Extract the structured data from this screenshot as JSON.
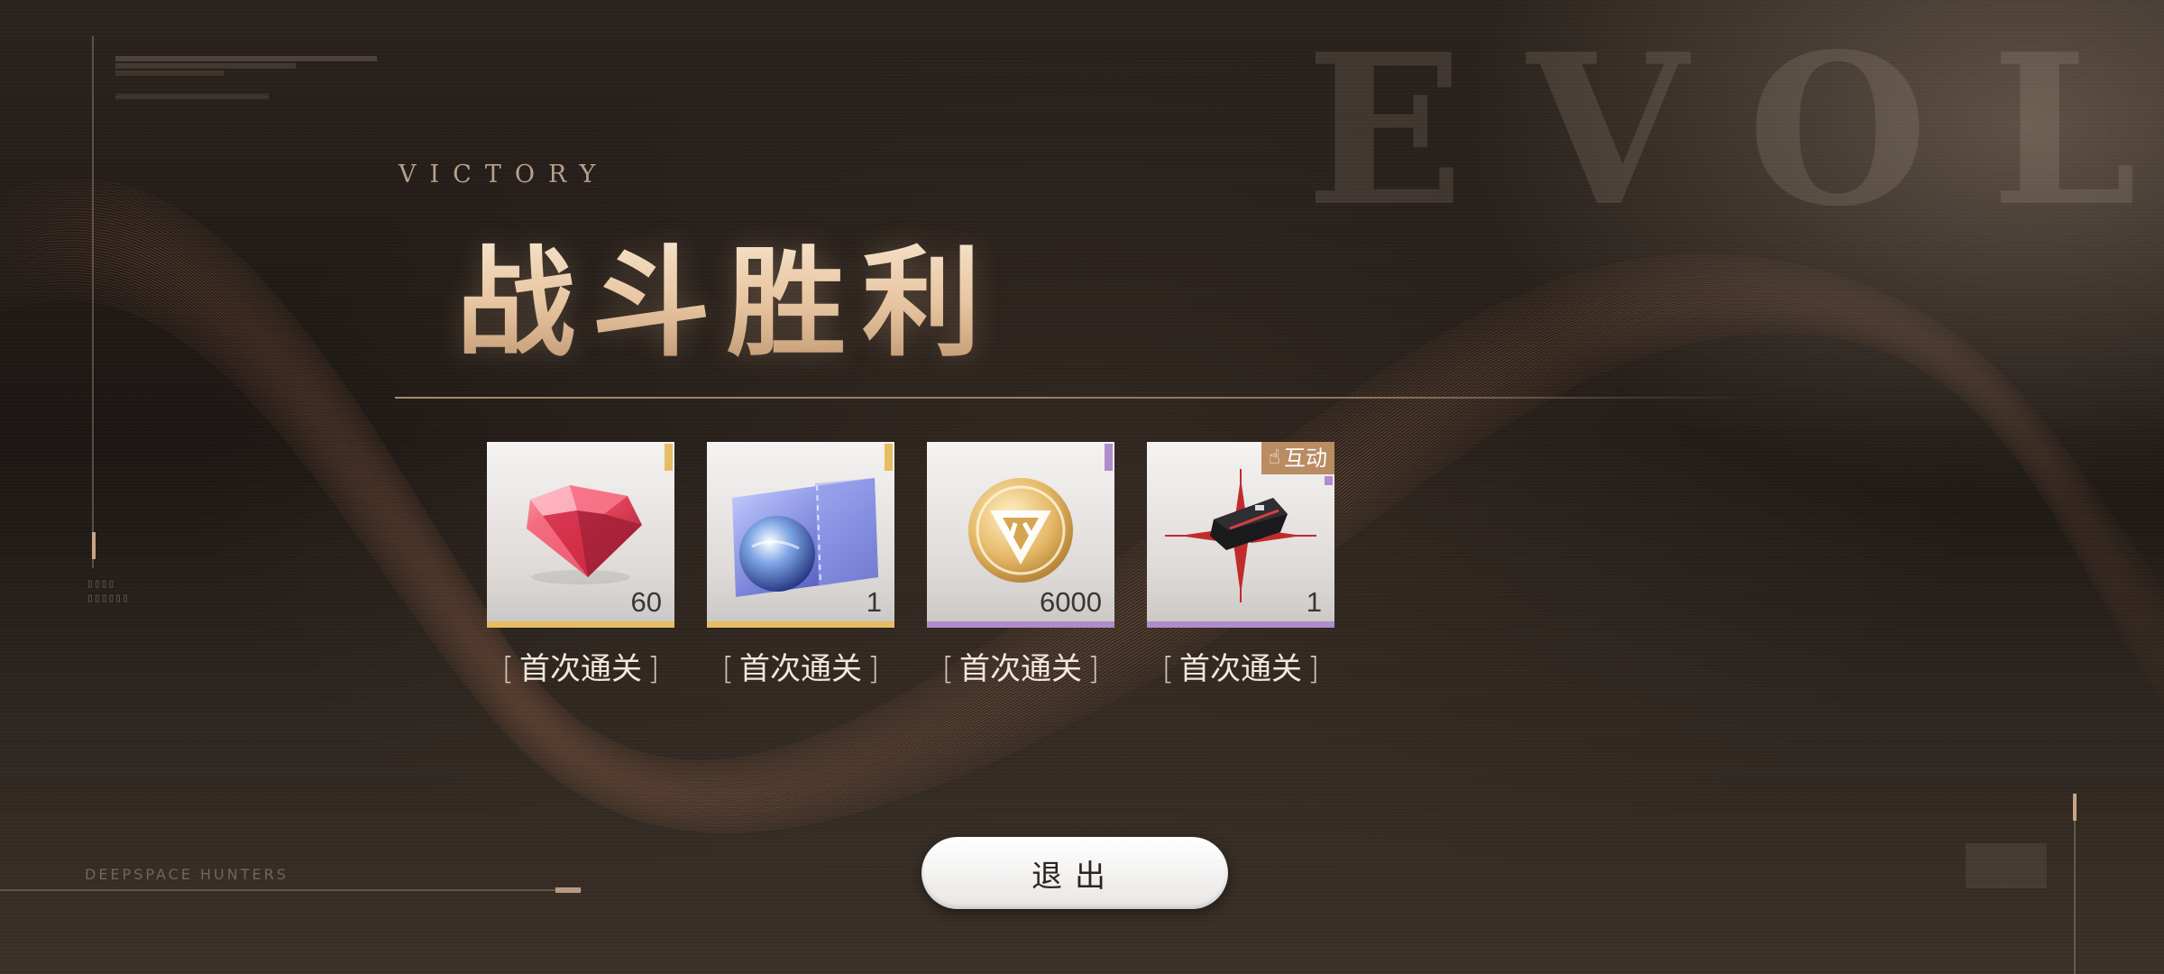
{
  "background": {
    "watermark_text": "EVOL"
  },
  "header": {
    "subtitle": "VICTORY",
    "title": "战斗胜利"
  },
  "rewards": [
    {
      "item": "pink-diamond-icon",
      "count": "60",
      "label": "首次通关",
      "rarity_color": "#e6bd62"
    },
    {
      "item": "earth-ticket-icon",
      "count": "1",
      "label": "首次通关",
      "rarity_color": "#e6bd62"
    },
    {
      "item": "gold-coin-icon",
      "count": "6000",
      "label": "首次通关",
      "rarity_color": "#b08ccc"
    },
    {
      "item": "black-chip-icon",
      "count": "1",
      "label": "首次通关",
      "rarity_color": "#b08ccc",
      "badge": "互动"
    }
  ],
  "exit_button": {
    "label": "退出"
  },
  "footer": {
    "brand": "DEEPSPACE HUNTERS"
  },
  "colors": {
    "accent": "#c9a585",
    "title_gold": "#e8c7a3"
  }
}
